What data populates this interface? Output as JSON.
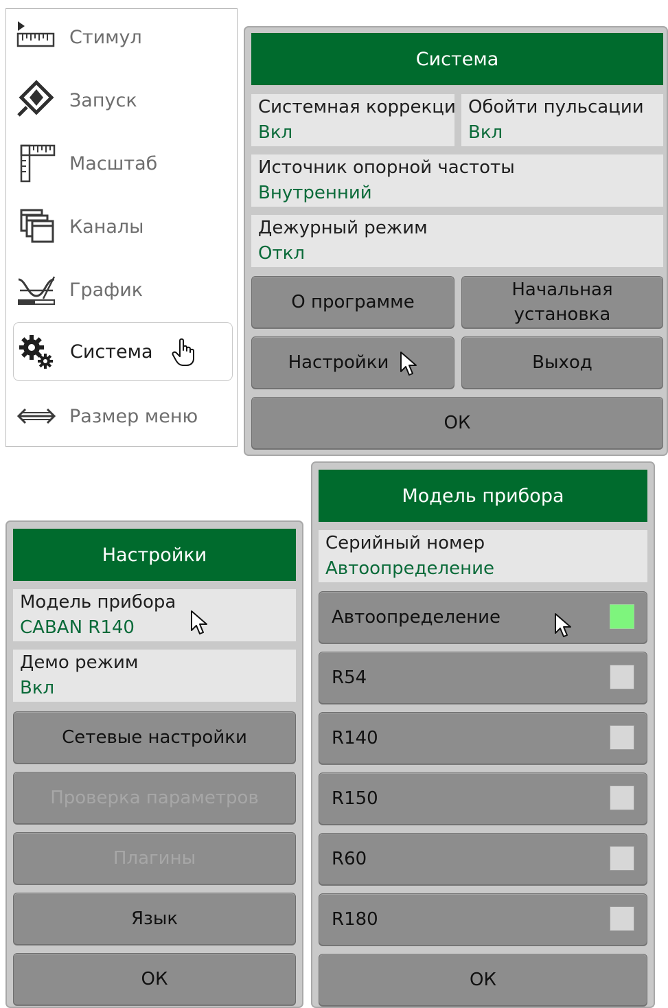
{
  "main_menu": {
    "items": [
      {
        "label": "Стимул",
        "icon": "stimulus-ruler-icon"
      },
      {
        "label": "Запуск",
        "icon": "trigger-diamond-icon"
      },
      {
        "label": "Масштаб",
        "icon": "scale-ruler-icon"
      },
      {
        "label": "Каналы",
        "icon": "channels-windows-icon"
      },
      {
        "label": "График",
        "icon": "trace-wave-icon"
      },
      {
        "label": "Система",
        "icon": "gears-icon",
        "active": true
      },
      {
        "label": "Размер меню",
        "icon": "resize-arrows-icon"
      }
    ]
  },
  "system_panel": {
    "title": "Система",
    "system_correction": {
      "title": "Системная коррекци",
      "value": "Вкл"
    },
    "bypass_ripple": {
      "title": "Обойти пульсации",
      "value": "Вкл"
    },
    "ref_source": {
      "title": "Источник опорной частоты",
      "value": "Внутренний"
    },
    "standby": {
      "title": "Дежурный режим",
      "value": "Откл"
    },
    "about_label": "О программе",
    "preset_label_line1": "Начальная",
    "preset_label_line2": "установка",
    "settings_label": "Настройки",
    "exit_label": "Выход",
    "ok_label": "ОК"
  },
  "settings_panel": {
    "title": "Настройки",
    "model": {
      "title": "Модель прибора",
      "value": "CABAN R140"
    },
    "demo": {
      "title": "Демо режим",
      "value": "Вкл"
    },
    "network_label": "Сетевые настройки",
    "check_params_label": "Проверка параметров",
    "plugins_label": "Плагины",
    "language_label": "Язык",
    "ok_label": "ОК"
  },
  "model_panel": {
    "title": "Модель прибора",
    "serial": {
      "title": "Серийный номер",
      "value": "Автоопределение"
    },
    "options": [
      {
        "label": "Автоопределение",
        "checked": true
      },
      {
        "label": "R54",
        "checked": false
      },
      {
        "label": "R140",
        "checked": false
      },
      {
        "label": "R150",
        "checked": false
      },
      {
        "label": "R60",
        "checked": false
      },
      {
        "label": "R180",
        "checked": false
      }
    ],
    "ok_label": "ОК"
  },
  "colors": {
    "header_green": "#006b2d",
    "value_green": "#0b6b3a",
    "checkbox_on": "#7ef57d",
    "button_gray": "#8d8d8d"
  }
}
